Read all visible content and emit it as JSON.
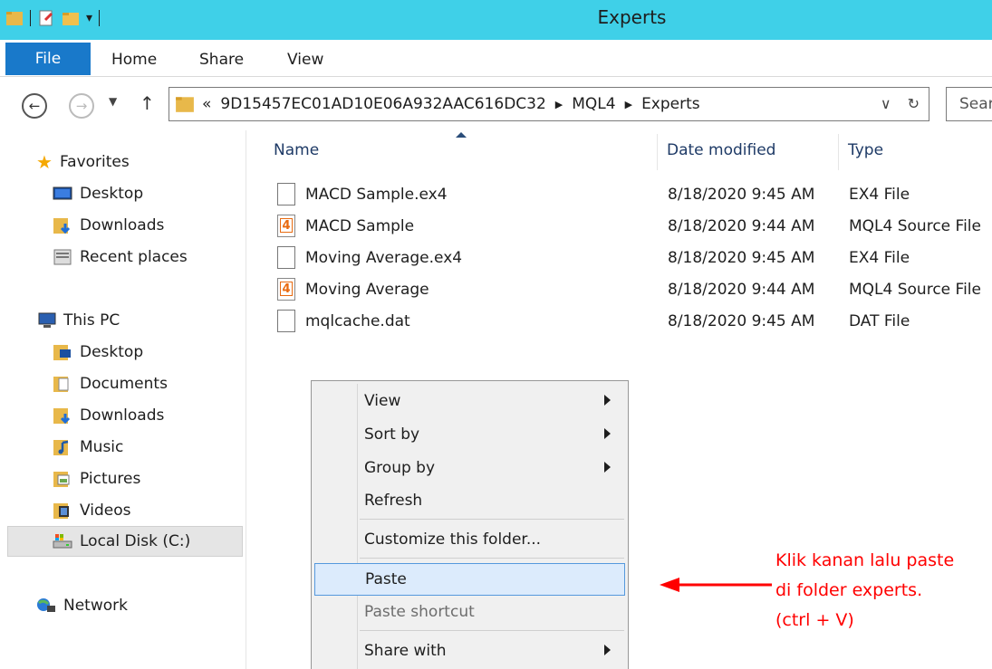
{
  "window": {
    "title": "Experts"
  },
  "ribbon": {
    "tabs": {
      "file": "File",
      "home": "Home",
      "share": "Share",
      "view": "View"
    }
  },
  "address": {
    "overflow": "«",
    "crumbs": [
      "9D15457EC01AD10E06A932AAC616DC32",
      "MQL4",
      "Experts"
    ],
    "search_placeholder": "Sear"
  },
  "nav": {
    "favorites": {
      "label": "Favorites",
      "items": [
        "Desktop",
        "Downloads",
        "Recent places"
      ]
    },
    "this_pc": {
      "label": "This PC",
      "items": [
        "Desktop",
        "Documents",
        "Downloads",
        "Music",
        "Pictures",
        "Videos",
        "Local Disk (C:)"
      ]
    },
    "network": {
      "label": "Network"
    }
  },
  "columns": {
    "name": "Name",
    "date": "Date modified",
    "type": "Type"
  },
  "files": [
    {
      "name": "MACD Sample.ex4",
      "date": "8/18/2020 9:45 AM",
      "type": "EX4 File",
      "icon": "blank-file-icon"
    },
    {
      "name": "MACD Sample",
      "date": "8/18/2020 9:44 AM",
      "type": "MQL4 Source File",
      "icon": "mql4-file-icon"
    },
    {
      "name": "Moving Average.ex4",
      "date": "8/18/2020 9:45 AM",
      "type": "EX4 File",
      "icon": "blank-file-icon"
    },
    {
      "name": "Moving Average",
      "date": "8/18/2020 9:44 AM",
      "type": "MQL4 Source File",
      "icon": "mql4-file-icon"
    },
    {
      "name": "mqlcache.dat",
      "date": "8/18/2020 9:45 AM",
      "type": "DAT File",
      "icon": "blank-file-icon"
    }
  ],
  "mql_icon_glyph": "4",
  "context_menu": {
    "view": "View",
    "sort_by": "Sort by",
    "group_by": "Group by",
    "refresh": "Refresh",
    "customize": "Customize this folder...",
    "paste": "Paste",
    "paste_shortcut": "Paste shortcut",
    "share_with": "Share with"
  },
  "annotation": {
    "line1": "Klik kanan lalu paste",
    "line2": "di folder experts.",
    "line3": "(ctrl + V)",
    "color": "#ff0000"
  },
  "colors": {
    "titlebar": "#3fd0e8",
    "file_tab": "#1979ca",
    "menu_highlight": "#dcebfc"
  }
}
